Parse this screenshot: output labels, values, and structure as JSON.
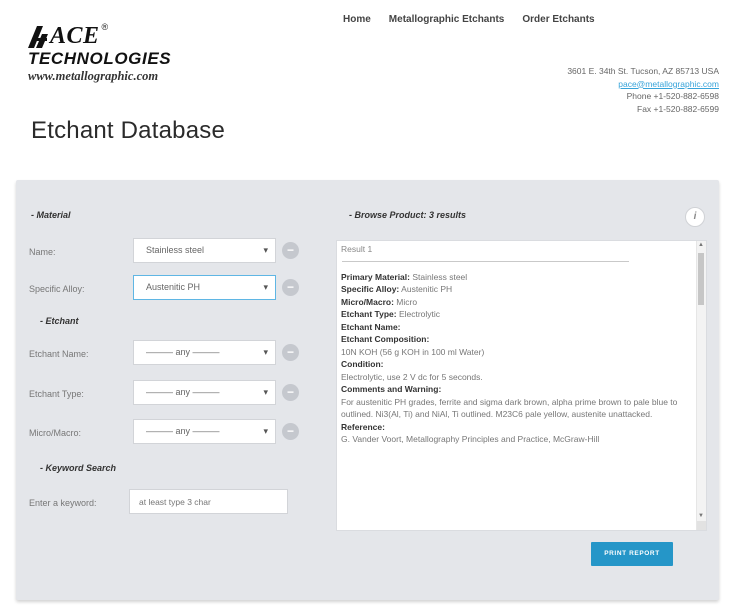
{
  "brand": {
    "name_line1": "ACE",
    "registered": "®",
    "name_line2": "TECHNOLOGIES",
    "url": "www.metallographic.com"
  },
  "nav": [
    {
      "label": "Home"
    },
    {
      "label": "Metallographic Etchants"
    },
    {
      "label": "Order Etchants"
    }
  ],
  "contact": {
    "address": "3601 E. 34th St. Tucson, AZ 85713 USA",
    "email": "pace@metallographic.com",
    "phone": "Phone +1-520-882-6598",
    "fax": "Fax +1-520-882-6599"
  },
  "page_title": "Etchant Database",
  "filters": {
    "material_heading": "- Material",
    "name_label": "Name:",
    "name_value": "Stainless steel",
    "alloy_label": "Specific Alloy:",
    "alloy_value": "Austenitic PH",
    "etchant_heading": "- Etchant",
    "etchant_name_label": "Etchant Name:",
    "etchant_name_value": "——— any ———",
    "etchant_type_label": "Etchant Type:",
    "etchant_type_value": "——— any ———",
    "micromacro_label": "Micro/Macro:",
    "micromacro_value": "——— any ———",
    "keyword_heading": "- Keyword Search",
    "keyword_label": "Enter a keyword:",
    "keyword_placeholder": "at least type 3 char",
    "minus_symbol": "−",
    "chevron_symbol": "▾"
  },
  "results": {
    "heading": "- Browse Product: 3 results",
    "info_symbol": "i",
    "result_label": "Result 1",
    "primary_material_label": "Primary Material:",
    "primary_material_value": "Stainless steel",
    "specific_alloy_label": "Specific Alloy:",
    "specific_alloy_value": "Austenitic PH",
    "micromacro_label": "Micro/Macro:",
    "micromacro_value": "Micro",
    "etchant_type_label": "Etchant Type:",
    "etchant_type_value": "Electrolytic",
    "etchant_name_label": "Etchant Name:",
    "etchant_composition_label": "Etchant Composition:",
    "etchant_composition_value": "10N KOH (56 g KOH in 100 ml Water)",
    "condition_label": "Condition:",
    "condition_value": "Electrolytic, use 2 V dc for 5 seconds.",
    "comments_label": "Comments and Warning:",
    "comments_value": "For austenitic PH grades, ferrite and sigma dark brown, alpha prime brown to pale blue to outlined. Ni3(Al, Ti) and NiAl, Ti outlined. M23C6 pale yellow, austenite unattacked.",
    "reference_label": "Reference:",
    "reference_value": "G. Vander Voort, Metallography Principles and Practice, McGraw-Hill"
  },
  "print_button": "PRINT REPORT",
  "colors": {
    "panel_bg": "#e4e6ea",
    "accent": "#2596c8",
    "link": "#36a3d9"
  }
}
